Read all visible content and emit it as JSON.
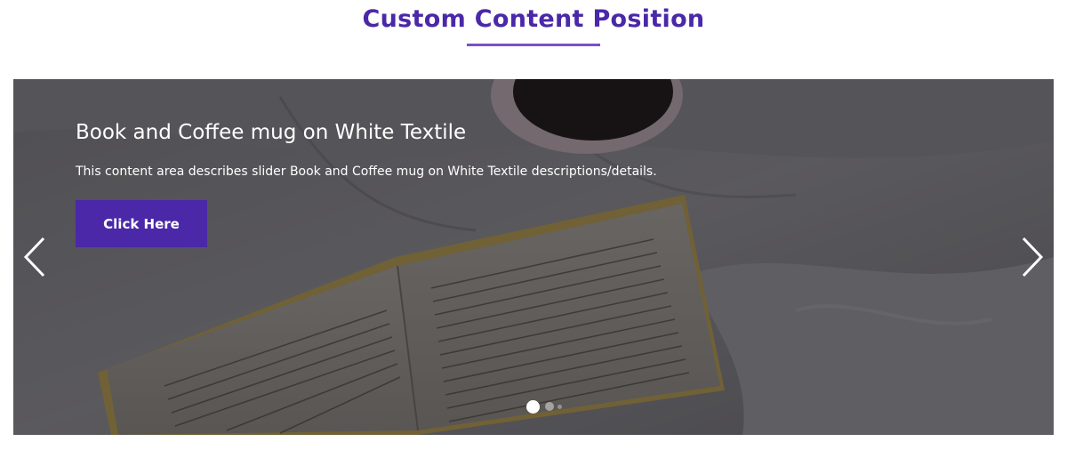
{
  "section": {
    "title": "Custom Content Position"
  },
  "slider": {
    "slide_title": "Book and Coffee mug on White Textile",
    "slide_description": "This content area describes slider Book and Coffee mug on White Textile descriptions/details.",
    "button_label": "Click Here",
    "active_slide": 1,
    "slide_count": 3,
    "prev_icon": "chevron-left-icon",
    "next_icon": "chevron-right-icon"
  },
  "colors": {
    "brand_purple": "#4a28a8",
    "underline_purple": "#7b4fc9",
    "overlay": "#2c2a2e",
    "text_on_image": "#ffffff"
  }
}
